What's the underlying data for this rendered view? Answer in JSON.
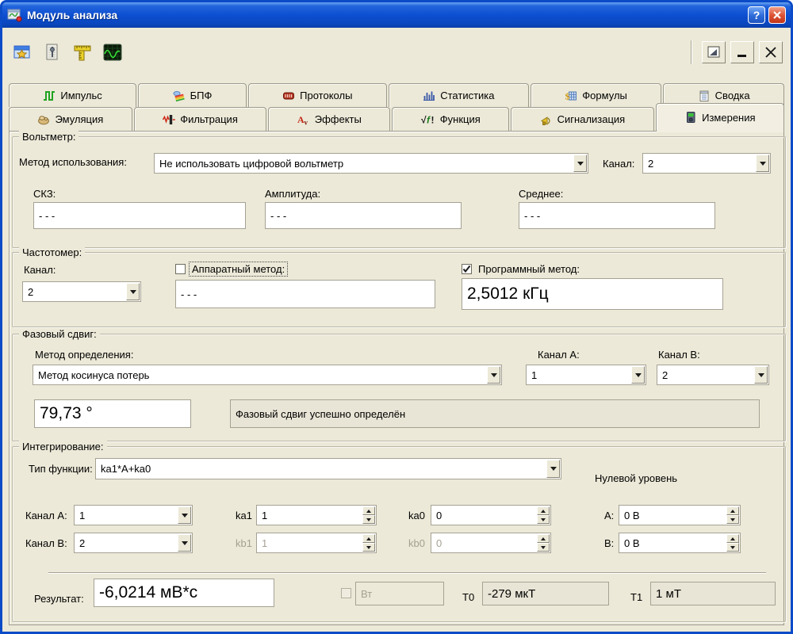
{
  "window": {
    "title": "Модуль анализа",
    "help_label": "?",
    "titlebar_icons": [
      "app-icon",
      "help-icon",
      "close-icon"
    ]
  },
  "toolbar": {
    "left_icons": [
      "window-star-icon",
      "journal-icon",
      "ruler-icon",
      "oscilloscope-icon"
    ],
    "right_icons": [
      "preview-icon",
      "minimize-icon",
      "close-x-icon"
    ]
  },
  "tabs": {
    "row1": [
      {
        "label": "Импульс",
        "icon": "pulse-icon"
      },
      {
        "label": "БПФ",
        "icon": "spectrum-icon"
      },
      {
        "label": "Протоколы",
        "icon": "protocols-icon"
      },
      {
        "label": "Статистика",
        "icon": "statistics-icon"
      },
      {
        "label": "Формулы",
        "icon": "formulas-icon"
      },
      {
        "label": "Сводка",
        "icon": "summary-icon"
      }
    ],
    "row2": [
      {
        "label": "Эмуляция",
        "icon": "emulation-icon"
      },
      {
        "label": "Фильтрация",
        "icon": "filtration-icon"
      },
      {
        "label": "Эффекты",
        "icon": "effects-icon"
      },
      {
        "label": "Функция",
        "icon": "function-icon"
      },
      {
        "label": "Сигнализация",
        "icon": "signaling-icon"
      },
      {
        "label": "Измерения",
        "icon": "measurements-icon",
        "active": true
      }
    ]
  },
  "voltmeter": {
    "group_label": "Вольтметр:",
    "method_label": "Метод использования:",
    "method_value": "Не использовать цифровой вольтметр",
    "channel_label": "Канал:",
    "channel_value": "2",
    "rms_label": "СКЗ:",
    "rms_value": "- - -",
    "amplitude_label": "Амплитуда:",
    "amplitude_value": "- - -",
    "mean_label": "Среднее:",
    "mean_value": "- - -"
  },
  "frequency_meter": {
    "group_label": "Частотомер:",
    "channel_label": "Канал:",
    "channel_value": "2",
    "hardware_label": "Аппаратный метод:",
    "hardware_checked": false,
    "hardware_value": "- - -",
    "software_label": "Программный метод:",
    "software_checked": true,
    "software_value": "2,5012 кГц"
  },
  "phase_shift": {
    "group_label": "Фазовый сдвиг:",
    "method_label": "Метод определения:",
    "method_value": "Метод косинуса потерь",
    "channel_a_label": "Канал A:",
    "channel_a_value": "1",
    "channel_b_label": "Канал B:",
    "channel_b_value": "2",
    "result_value": "79,73 °",
    "status_text": "Фазовый сдвиг успешно определён"
  },
  "integration": {
    "group_label": "Интегрирование:",
    "function_label": "Тип функции:",
    "function_value": "ka1*A+ka0",
    "zero_level_label": "Нулевой уровень",
    "channel_a_label": "Канал A:",
    "channel_a_value": "1",
    "channel_b_label": "Канал B:",
    "channel_b_value": "2",
    "ka1_label": "ka1",
    "ka1_value": "1",
    "ka0_label": "ka0",
    "ka0_value": "0",
    "kb1_label": "kb1",
    "kb1_value": "1",
    "kb0_label": "kb0",
    "kb0_value": "0",
    "zero_a_label": "A:",
    "zero_a_value": "0 В",
    "zero_b_label": "B:",
    "zero_b_value": "0 В",
    "result_label": "Результат:",
    "result_value": "-6,0214 мВ*с",
    "watt_label": "Вт",
    "watt_checked": false,
    "t0_label": "T0",
    "t0_value": "-279 мкТ",
    "t1_label": "T1",
    "t1_value": "1 мТ"
  },
  "colors": {
    "window_frame": "#0B4BC8",
    "surface": "#ECE9D8",
    "titlebar_blue": "#0D50D2",
    "close_red": "#DE5438",
    "field_border": "#A5A294"
  }
}
